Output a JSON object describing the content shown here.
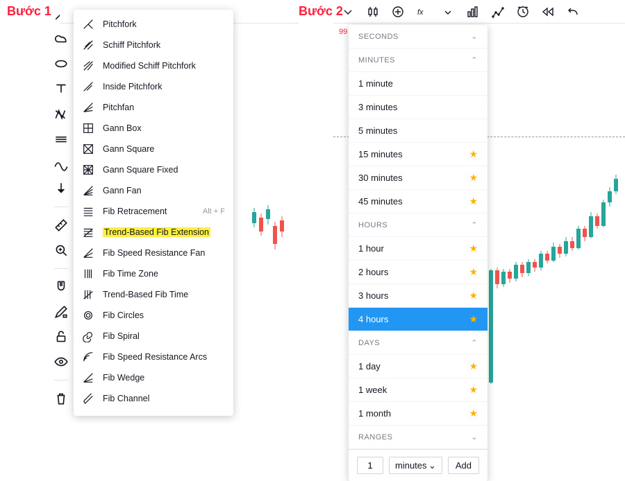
{
  "step_labels": {
    "step1": "Bước 1",
    "step2": "Bước 2"
  },
  "left_panel": {
    "ticker_small": "99",
    "sidebar_icons": [
      "pitchfork-icon",
      "cloud-icon",
      "ellipse-icon",
      "text-icon",
      "xabcd-icon",
      "long-position-icon",
      "wave-icon",
      "arrow-down-icon",
      "SEP",
      "ruler-icon",
      "zoom-in-icon",
      "SEP",
      "magnet-icon",
      "pencil-lock-icon",
      "unlock-icon",
      "eye-icon",
      "SEP",
      "trash-icon"
    ],
    "tools": [
      {
        "icon": "pitchfork-icon",
        "label": "Pitchfork"
      },
      {
        "icon": "schiff-pitchfork-icon",
        "label": "Schiff Pitchfork"
      },
      {
        "icon": "mod-schiff-pitchfork-icon",
        "label": "Modified Schiff Pitchfork"
      },
      {
        "icon": "inside-pitchfork-icon",
        "label": "Inside Pitchfork"
      },
      {
        "icon": "pitchfan-icon",
        "label": "Pitchfan"
      },
      {
        "icon": "gann-box-icon",
        "label": "Gann Box"
      },
      {
        "icon": "gann-square-icon",
        "label": "Gann Square"
      },
      {
        "icon": "gann-square-fixed-icon",
        "label": "Gann Square Fixed"
      },
      {
        "icon": "gann-fan-icon",
        "label": "Gann Fan"
      },
      {
        "icon": "fib-retracement-icon",
        "label": "Fib Retracement",
        "shortcut": "Alt + F"
      },
      {
        "icon": "trend-fib-ext-icon",
        "label": "Trend-Based Fib Extension",
        "highlight": true
      },
      {
        "icon": "fib-speed-resist-fan-icon",
        "label": "Fib Speed Resistance Fan"
      },
      {
        "icon": "fib-time-zone-icon",
        "label": "Fib Time Zone"
      },
      {
        "icon": "trend-fib-time-icon",
        "label": "Trend-Based Fib Time"
      },
      {
        "icon": "fib-circles-icon",
        "label": "Fib Circles"
      },
      {
        "icon": "fib-spiral-icon",
        "label": "Fib Spiral"
      },
      {
        "icon": "fib-speed-resist-arcs-icon",
        "label": "Fib Speed Resistance Arcs"
      },
      {
        "icon": "fib-wedge-icon",
        "label": "Fib Wedge"
      },
      {
        "icon": "fib-channel-icon",
        "label": "Fib Channel"
      }
    ]
  },
  "right_panel": {
    "toolbar_icons": [
      "chevron-down-icon",
      "candles-icon",
      "compare-icon",
      "fx-icon",
      "chevron-down-small-icon",
      "indicators-icon",
      "financials-icon",
      "alert-icon",
      "rewind-icon",
      "undo-icon"
    ],
    "sections": [
      {
        "title": "SECONDS",
        "collapsed": true,
        "items": []
      },
      {
        "title": "MINUTES",
        "collapsed": false,
        "items": [
          {
            "label": "1 minute",
            "star": false
          },
          {
            "label": "3 minutes",
            "star": false
          },
          {
            "label": "5 minutes",
            "star": false
          },
          {
            "label": "15 minutes",
            "star": true
          },
          {
            "label": "30 minutes",
            "star": true
          },
          {
            "label": "45 minutes",
            "star": true
          }
        ]
      },
      {
        "title": "HOURS",
        "collapsed": false,
        "items": [
          {
            "label": "1 hour",
            "star": true
          },
          {
            "label": "2 hours",
            "star": true
          },
          {
            "label": "3 hours",
            "star": true
          },
          {
            "label": "4 hours",
            "star": true,
            "active": true
          }
        ]
      },
      {
        "title": "DAYS",
        "collapsed": false,
        "items": [
          {
            "label": "1 day",
            "star": true
          },
          {
            "label": "1 week",
            "star": true
          },
          {
            "label": "1 month",
            "star": true
          }
        ]
      },
      {
        "title": "RANGES",
        "collapsed": true,
        "items": []
      }
    ],
    "custom": {
      "value": "1",
      "unit": "minutes",
      "add_label": "Add"
    }
  },
  "colors": {
    "up": "#26a69a",
    "down": "#ef5350",
    "accent": "#2196f3",
    "star": "#ffb300"
  }
}
